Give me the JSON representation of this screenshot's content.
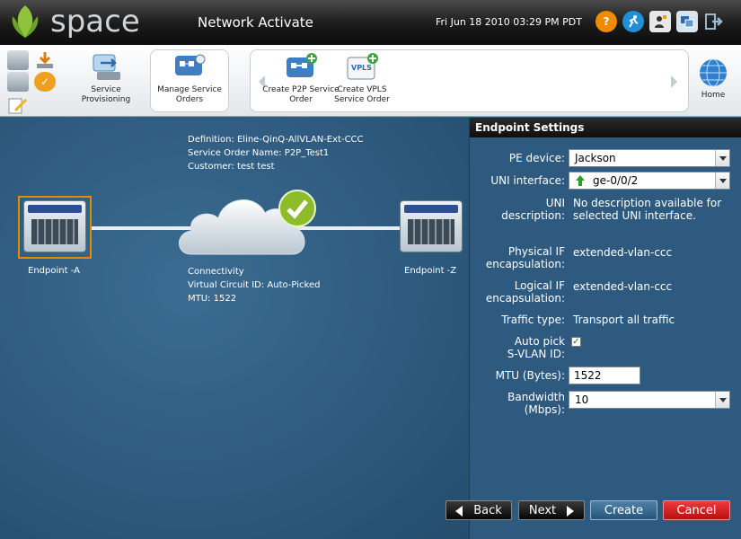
{
  "brand": {
    "name": "space",
    "accent": "#8fc33c"
  },
  "header": {
    "app_title": "Network Activate",
    "datetime": "Fri Jun 18 2010 03:29 PM PDT",
    "icons": [
      "help-icon",
      "runner-icon",
      "user-icon",
      "windows-icon",
      "logout-icon"
    ]
  },
  "toolbar": {
    "service_provisioning": "Service Provisioning",
    "manage_service_orders": "Manage Service Orders",
    "create_p2p": "Create P2P Service Order",
    "create_vpls": "Create VPLS Service Order",
    "home": "Home"
  },
  "canvas": {
    "definition": "Definition: Eline-QinQ-AllVLAN-Ext-CCC",
    "service_order_name": "Service Order Name: P2P_Test1",
    "customer": "Customer: test test",
    "endpoint_a": "Endpoint -A",
    "endpoint_z": "Endpoint -Z",
    "connectivity": "Connectivity",
    "virtual_circuit": "Virtual Circuit ID: Auto-Picked",
    "mtu": "MTU: 1522"
  },
  "panel": {
    "title": "Endpoint Settings",
    "pe_device_label": "PE device:",
    "pe_device_value": "Jackson",
    "uni_interface_label": "UNI interface:",
    "uni_interface_value": "ge-0/0/2",
    "uni_desc_label": "UNI description:",
    "uni_desc_value": "No description available for selected UNI interface.",
    "physical_if_label": "Physical IF encapsulation:",
    "physical_if_value": "extended-vlan-ccc",
    "logical_if_label": "Logical IF encapsulation:",
    "logical_if_value": "extended-vlan-ccc",
    "traffic_type_label": "Traffic type:",
    "traffic_type_value": "Transport all traffic",
    "auto_pick_label": "Auto pick S-VLAN ID:",
    "auto_pick_checked": true,
    "mtu_label": "MTU (Bytes):",
    "mtu_value": "1522",
    "bandwidth_label": "Bandwidth (Mbps):",
    "bandwidth_value": "10"
  },
  "footer": {
    "back": "Back",
    "next": "Next",
    "create": "Create",
    "cancel": "Cancel"
  }
}
